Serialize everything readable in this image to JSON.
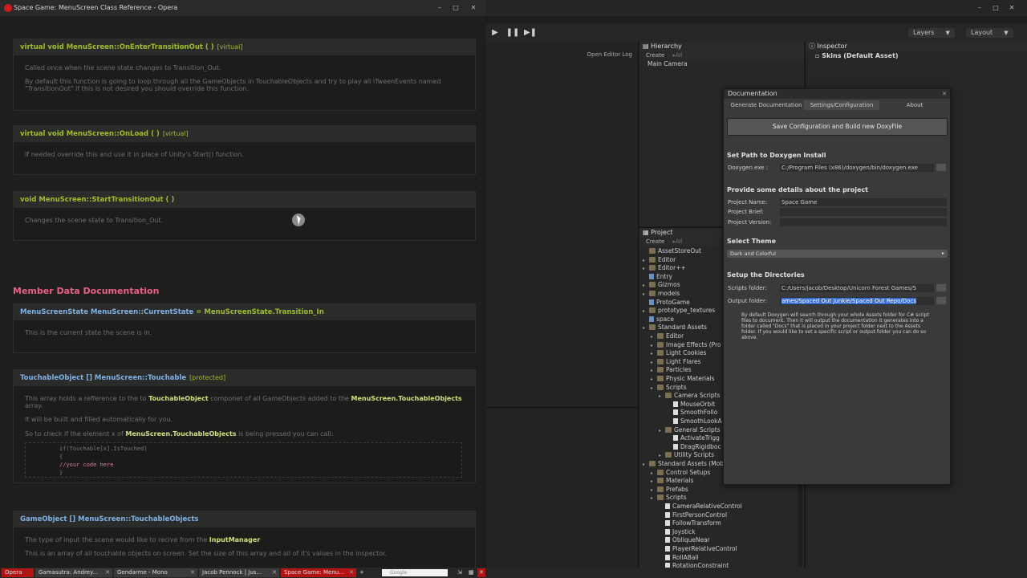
{
  "opera": {
    "title": "Space Game: MenuScreen Class Reference - Opera",
    "sections": [
      {
        "heading": "virtual void MenuScreen::OnEnterTransitionOut ( )",
        "tag": "[virtual]",
        "paragraphs": [
          "Called once when the scene state changes to Transition_Out.",
          "By default this function is going to loop through all the GameObjects in TouchableObjects and try to play all iTweenEvents named \"TransitionOut\" if this is not desired you should override this function."
        ]
      },
      {
        "heading": "virtual void MenuScreen::OnLoad ( )",
        "tag": "[virtual]",
        "paragraphs": [
          "If needed override this and use it in place of Unity's Start() function."
        ]
      },
      {
        "heading": "void MenuScreen::StartTransitionOut ( )",
        "tag": "",
        "paragraphs": [
          "Changes the scene state to Transition_Out."
        ]
      }
    ],
    "member_heading": "Member Data Documentation",
    "members": [
      {
        "heading_type": "MenuScreenState MenuScreen::CurrentState",
        "heading_value": "= MenuScreenState.Transition_In",
        "paragraph": "This is the current state the scene is in."
      },
      {
        "heading_type": "TouchableObject [] MenuScreen::Touchable",
        "tag": "[protected]",
        "p1_a": "This array holds a refference to the to",
        "p1_link1": "TouchableObject",
        "p1_b": "componet of all GameObjects added to the",
        "p1_link2": "MenuScreen.TouchableObjects",
        "p1_c": "array.",
        "p2": "It will be built and filled automatically for you.",
        "p3_a": "So to check if the element x of",
        "p3_link": "MenuScreen.TouchableObjects",
        "p3_b": "is being pressed you can call:",
        "code": [
          "if(Touchable[x].IsTouched)",
          "{",
          "    //your code here",
          "}"
        ]
      },
      {
        "heading_type": "GameObject [] MenuScreen::TouchableObjects",
        "p1_a": "The type of input the scene would like to recive from the",
        "p1_link": "InputManager",
        "p2": "This is an array of all touchable objects on screen. Set the size of this array and all of it's values in the inspector."
      }
    ]
  },
  "unity": {
    "layers_label": "Layers",
    "layout_label": "Layout",
    "open_editor_log": "Open Editor Log",
    "hierarchy": {
      "tab": "Hierarchy",
      "create": "Create",
      "search": "▸All",
      "items": [
        "Main Camera"
      ]
    },
    "inspector": {
      "tab": "Inspector",
      "object": "Skins (Default Asset)"
    },
    "project": {
      "tab": "Project",
      "create": "Create",
      "search": "▸All",
      "tree": [
        {
          "label": "AssetStoreOut",
          "indent": 0,
          "kind": "folder",
          "arrow": false
        },
        {
          "label": "Editor",
          "indent": 0,
          "kind": "folder",
          "arrow": true
        },
        {
          "label": "Editor++",
          "indent": 0,
          "kind": "folder",
          "arrow": true
        },
        {
          "label": "Entry",
          "indent": 0,
          "kind": "scene",
          "arrow": false
        },
        {
          "label": "Gizmos",
          "indent": 0,
          "kind": "folder",
          "arrow": true
        },
        {
          "label": "models",
          "indent": 0,
          "kind": "folder",
          "arrow": true
        },
        {
          "label": "ProtoGame",
          "indent": 0,
          "kind": "scene",
          "arrow": false
        },
        {
          "label": "prototype_textures",
          "indent": 0,
          "kind": "folder",
          "arrow": true
        },
        {
          "label": "space",
          "indent": 0,
          "kind": "scene",
          "arrow": false
        },
        {
          "label": "Standard Assets",
          "indent": 0,
          "kind": "folder",
          "arrow": true
        },
        {
          "label": "Editor",
          "indent": 1,
          "kind": "folder",
          "arrow": true
        },
        {
          "label": "Image Effects (Pro",
          "indent": 1,
          "kind": "folder",
          "arrow": true
        },
        {
          "label": "Light Cookies",
          "indent": 1,
          "kind": "folder",
          "arrow": true
        },
        {
          "label": "Light Flares",
          "indent": 1,
          "kind": "folder",
          "arrow": true
        },
        {
          "label": "Particles",
          "indent": 1,
          "kind": "folder",
          "arrow": true
        },
        {
          "label": "Physic Materials",
          "indent": 1,
          "kind": "folder",
          "arrow": true
        },
        {
          "label": "Scripts",
          "indent": 1,
          "kind": "folder",
          "arrow": true
        },
        {
          "label": "Camera Scripts",
          "indent": 2,
          "kind": "folder",
          "arrow": true
        },
        {
          "label": "MouseOrbit",
          "indent": 3,
          "kind": "file",
          "arrow": false
        },
        {
          "label": "SmoothFollo",
          "indent": 3,
          "kind": "file",
          "arrow": false
        },
        {
          "label": "SmoothLookA",
          "indent": 3,
          "kind": "file",
          "arrow": false
        },
        {
          "label": "General Scripts",
          "indent": 2,
          "kind": "folder",
          "arrow": true
        },
        {
          "label": "ActivateTrigg",
          "indent": 3,
          "kind": "file",
          "arrow": false
        },
        {
          "label": "DragRigidboc",
          "indent": 3,
          "kind": "file",
          "arrow": false
        },
        {
          "label": "Utility Scripts",
          "indent": 2,
          "kind": "folder",
          "arrow": true
        },
        {
          "label": "Standard Assets (Mob",
          "indent": 0,
          "kind": "folder",
          "arrow": true
        },
        {
          "label": "Control Setups",
          "indent": 1,
          "kind": "folder",
          "arrow": true
        },
        {
          "label": "Materials",
          "indent": 1,
          "kind": "folder",
          "arrow": true
        },
        {
          "label": "Prefabs",
          "indent": 1,
          "kind": "folder",
          "arrow": true
        },
        {
          "label": "Scripts",
          "indent": 1,
          "kind": "folder",
          "arrow": true
        },
        {
          "label": "CameraRelativeControl",
          "indent": 2,
          "kind": "file",
          "arrow": false
        },
        {
          "label": "FirstPersonControl",
          "indent": 2,
          "kind": "file",
          "arrow": false
        },
        {
          "label": "FollowTransform",
          "indent": 2,
          "kind": "file",
          "arrow": false
        },
        {
          "label": "Joystick",
          "indent": 2,
          "kind": "file",
          "arrow": false
        },
        {
          "label": "ObliqueNear",
          "indent": 2,
          "kind": "file",
          "arrow": false
        },
        {
          "label": "PlayerRelativeControl",
          "indent": 2,
          "kind": "file",
          "arrow": false
        },
        {
          "label": "RollABall",
          "indent": 2,
          "kind": "file",
          "arrow": false
        },
        {
          "label": "RotationConstraint",
          "indent": 2,
          "kind": "file",
          "arrow": false
        }
      ]
    },
    "docwin": {
      "title": "Documentation",
      "tabs": [
        "Generate Documentation",
        "Settings/Configuration",
        "About"
      ],
      "save_button": "Save Configuration and Build new DoxyFile",
      "sec_path": "Set Path to Doxygen Install",
      "doxygen_label": "Doxygen.exe :",
      "doxygen_value": "C:/Program Files (x86)/doxygen/bin/doxygen.exe",
      "sec_project": "Provide some details about the project",
      "project_name_label": "Project Name:",
      "project_name_value": "Space Game",
      "project_brief_label": "Project Brief:",
      "project_brief_value": "",
      "project_version_label": "Project Version:",
      "project_version_value": "",
      "sec_theme": "Select Theme",
      "theme_value": "Dark and Colorful",
      "sec_dirs": "Setup the Directories",
      "scripts_label": "Scripts folder:",
      "scripts_value": "C:/Users/jacob/Desktop/Unicorn Forest Games/S",
      "output_label": "Output folder:",
      "output_value": "ames/Spaced Out Junkie/Spaced Out Repo/Docs",
      "help": "By default Doxygen will search through your whole Assets folder for C# script files to document. Then it will output the documentation it generates into a folder called \"Docs\" that is placed in your project folder next to the Assets folder. If you would like to set a specific script or output folder you can do so above."
    }
  },
  "taskbar": {
    "items": [
      {
        "label": "Opera",
        "color": "#b21414"
      },
      {
        "label": "Gamasutra: Andrey...",
        "color": "#3a3a3a"
      },
      {
        "label": "Gendarme - Mono",
        "color": "#3a3a3a"
      },
      {
        "label": "Jacob Pennock | Jus...",
        "color": "#3a3a3a"
      },
      {
        "label": "Space Game: Menu...",
        "color": "#b21414"
      }
    ],
    "search_placeholder": "Google"
  }
}
